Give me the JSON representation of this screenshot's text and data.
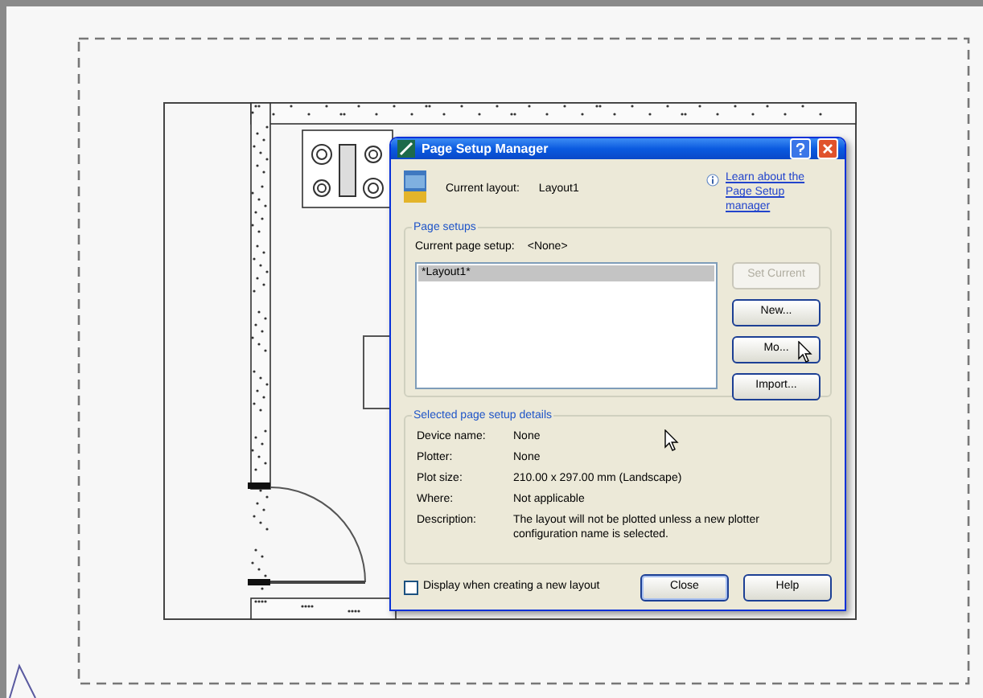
{
  "dialog": {
    "title": "Page Setup Manager",
    "current_layout_label": "Current layout:",
    "current_layout": "Layout1",
    "help_link": "Learn about the Page Setup manager",
    "page_setups": {
      "title": "Page setups",
      "current_label": "Current page setup:",
      "current_value": "<None>",
      "items": [
        {
          "label": "*Layout1*",
          "selected": true
        }
      ],
      "buttons": [
        {
          "label": "Set Current",
          "disabled": true
        },
        {
          "label": "New...",
          "disabled": false
        },
        {
          "label": "Mo...",
          "disabled": false
        },
        {
          "label": "Import...",
          "disabled": false
        }
      ]
    },
    "details": {
      "title": "Selected page setup details",
      "rows": [
        {
          "label": "Device name:",
          "value": "None"
        },
        {
          "label": "Plotter:",
          "value": "None"
        },
        {
          "label": "Plot size:",
          "value": "210.00 x 297.00 mm (Landscape)"
        },
        {
          "label": "Where:",
          "value": "Not applicable"
        },
        {
          "label": "Description:",
          "value": "The layout will not be plotted unless a new plotter configuration name is selected."
        }
      ]
    },
    "display_checkbox": {
      "label": "Display when creating a new layout",
      "checked": false
    },
    "buttons": [
      {
        "label": "Close",
        "default": true
      },
      {
        "label": "Help",
        "default": false
      }
    ]
  }
}
